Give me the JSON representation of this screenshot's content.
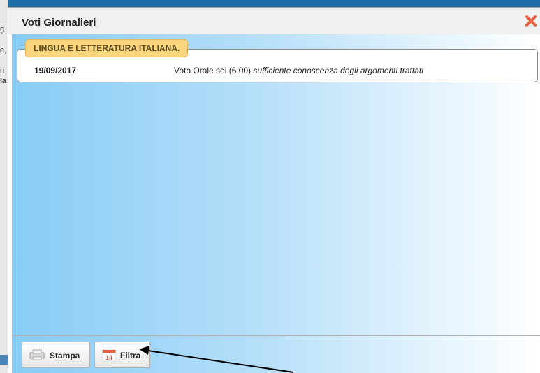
{
  "background": {
    "fragments": [
      "g",
      "e,",
      "u",
      "la"
    ]
  },
  "dialog": {
    "title": "Voti Giornalieri",
    "close_icon": "close-icon"
  },
  "grade": {
    "subject": "LINGUA E LETTERATURA ITALIANA.",
    "date": "19/09/2017",
    "description_plain": "Voto Orale sei (6.00) ",
    "description_italic": "sufficiente conoscenza degli argomenti trattati"
  },
  "footer": {
    "stampa_label": "Stampa",
    "filtra_label": "Filtra",
    "filtra_icon_day": "14"
  },
  "colors": {
    "accent_tab": "#fbd57e",
    "close": "#e8613f",
    "gradient_start": "#88ccf5"
  }
}
